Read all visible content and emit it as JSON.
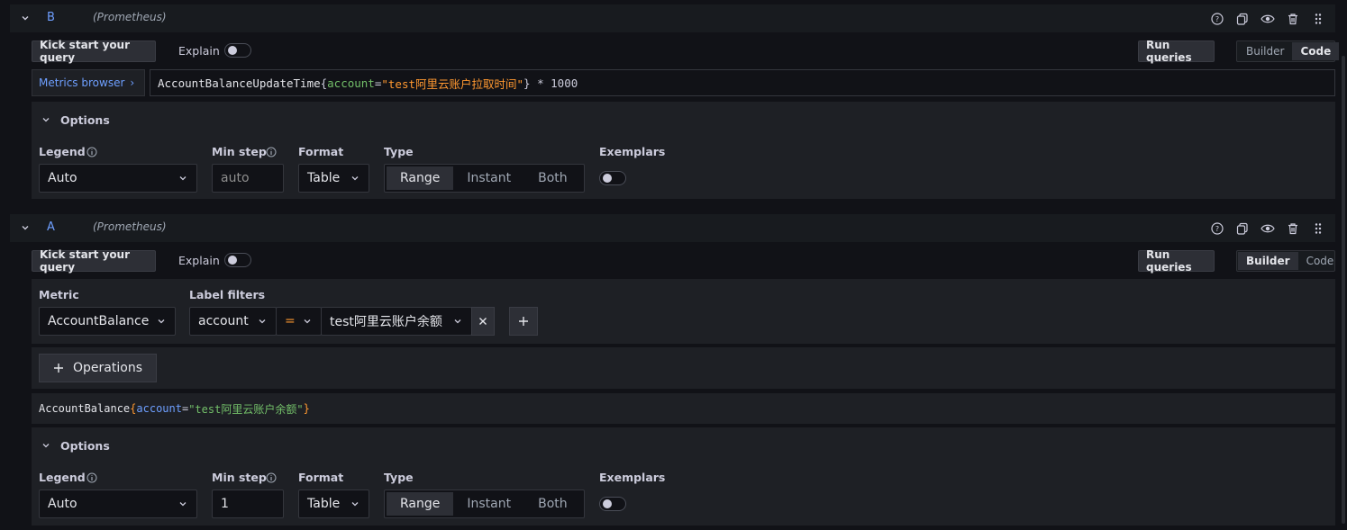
{
  "queries": [
    {
      "ref_id": "B",
      "datasource": "(Prometheus)",
      "kick_start": "Kick start your query",
      "explain": "Explain",
      "run_queries": "Run queries",
      "mode_builder": "Builder",
      "mode_code": "Code",
      "metrics_browser": "Metrics browser",
      "query_metric": "AccountBalanceUpdateTime",
      "query_label_key": "account",
      "query_label_value": "\"test阿里云账户拉取时间\"",
      "query_suffix": " * 1000",
      "options_label": "Options",
      "legend_label": "Legend",
      "legend_value": "Auto",
      "min_step_label": "Min step",
      "min_step_placeholder": "auto",
      "format_label": "Format",
      "format_value": "Table",
      "type_label": "Type",
      "type_range": "Range",
      "type_instant": "Instant",
      "type_both": "Both",
      "exemplars_label": "Exemplars"
    },
    {
      "ref_id": "A",
      "datasource": "(Prometheus)",
      "kick_start": "Kick start your query",
      "explain": "Explain",
      "run_queries": "Run queries",
      "mode_builder": "Builder",
      "mode_code": "Code",
      "metric_label": "Metric",
      "metric_value": "AccountBalance",
      "label_filters_label": "Label filters",
      "filter_key": "account",
      "filter_op": "=",
      "filter_value": "test阿里云账户余额",
      "operations": "Operations",
      "preview_metric": "AccountBalance",
      "preview_key": "account",
      "preview_value": "\"test阿里云账户余额\"",
      "options_label": "Options",
      "legend_label": "Legend",
      "legend_value": "Auto",
      "min_step_label": "Min step",
      "min_step_value": "1",
      "format_label": "Format",
      "format_value": "Table",
      "type_label": "Type",
      "type_range": "Range",
      "type_instant": "Instant",
      "type_both": "Both",
      "exemplars_label": "Exemplars"
    }
  ],
  "colors": {
    "accent_blue": "#6e9fff",
    "code_green": "#73bf69",
    "code_orange": "#ff9830",
    "code_red": "#f2495c"
  }
}
